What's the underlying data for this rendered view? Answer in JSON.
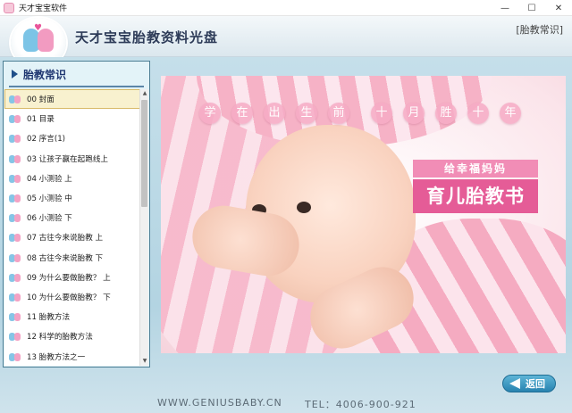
{
  "window": {
    "title": "天才宝宝软件",
    "minimize": "—",
    "maximize": "☐",
    "close": "✕"
  },
  "header": {
    "app_name": "天才宝宝胎教资料光盘",
    "section_tag": "[胎教常识]",
    "logo_icon": "babies-logo-icon"
  },
  "sidebar": {
    "title": "胎教常识",
    "items": [
      {
        "label": "00 封面",
        "selected": true
      },
      {
        "label": "01 目录"
      },
      {
        "label": "02 序言(1)"
      },
      {
        "label": "03 让孩子赢在起跑线上"
      },
      {
        "label": "04 小测验 上"
      },
      {
        "label": "05 小测验 中"
      },
      {
        "label": "06 小测验 下"
      },
      {
        "label": "07 古往今来说胎教 上"
      },
      {
        "label": "08 古往今来说胎教 下"
      },
      {
        "label": "09 为什么要做胎教？ 上"
      },
      {
        "label": "10 为什么要做胎教？ 下"
      },
      {
        "label": "11 胎教方法"
      },
      {
        "label": "12 科学的胎教方法"
      },
      {
        "label": "13 胎教方法之一"
      }
    ],
    "scroll_up": "▲",
    "scroll_down": "▼"
  },
  "main": {
    "slogan_chars_1": [
      "学",
      "在",
      "出",
      "生",
      "前"
    ],
    "slogan_chars_2": [
      "十",
      "月",
      "胜",
      "十",
      "年"
    ],
    "box_top": "给幸福妈妈",
    "box_bottom": "育儿胎教书"
  },
  "footer": {
    "url": "WWW.GENIUSBABY.CN",
    "tel": "TEL：4006-900-921",
    "back_label": "返回"
  },
  "colors": {
    "accent_pink": "#e55c97",
    "panel_blue": "#c5dfea",
    "title_navy": "#2d3b58"
  }
}
